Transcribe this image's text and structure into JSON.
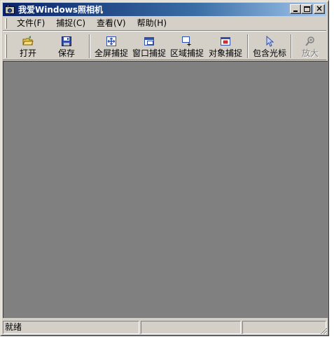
{
  "window": {
    "title": "我爱Windows照相机"
  },
  "menubar": {
    "items": [
      {
        "label": "文件(F)"
      },
      {
        "label": "捕捉(C)"
      },
      {
        "label": "查看(V)"
      },
      {
        "label": "帮助(H)"
      }
    ]
  },
  "toolbar": {
    "buttons": [
      {
        "label": "打开",
        "icon": "open-folder-icon"
      },
      {
        "label": "保存",
        "icon": "floppy-disk-icon"
      },
      {
        "label": "全屏捕捉",
        "icon": "fullscreen-capture-icon"
      },
      {
        "label": "窗口捕捉",
        "icon": "window-capture-icon"
      },
      {
        "label": "区域捕捉",
        "icon": "region-capture-icon"
      },
      {
        "label": "对象捕捉",
        "icon": "object-capture-icon"
      },
      {
        "label": "包含光标",
        "icon": "cursor-icon"
      },
      {
        "label": "放大",
        "icon": "zoom-icon",
        "disabled": true
      }
    ]
  },
  "statusbar": {
    "text": "就绪",
    "pane2": "",
    "pane3": ""
  },
  "colors": {
    "title_gradient_start": "#0a246a",
    "title_gradient_end": "#a6caf0",
    "face": "#d4d0c8",
    "canvas": "#808080"
  }
}
